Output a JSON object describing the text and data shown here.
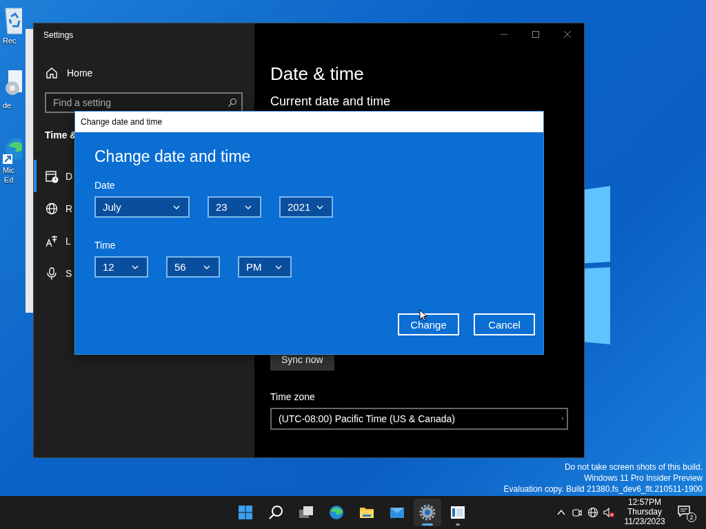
{
  "desktop": {
    "icons": [
      {
        "kind": "recycle-bin",
        "label": "Rec"
      },
      {
        "kind": "gear-file",
        "label": "de"
      },
      {
        "kind": "browser",
        "label": "Mic\nEd"
      }
    ]
  },
  "settings_window": {
    "title": "Settings",
    "home": "Home",
    "search": {
      "placeholder": "Find a setting"
    },
    "section": "Time &",
    "nav_items": [
      {
        "kind": "calendar",
        "label": "D",
        "selected": true
      },
      {
        "kind": "globe",
        "label": "R",
        "selected": false
      },
      {
        "kind": "language",
        "label": "L",
        "selected": false
      },
      {
        "kind": "microphone",
        "label": "S",
        "selected": false
      }
    ],
    "page": {
      "heading": "Date & time",
      "subheading": "Current date and time",
      "sync_button": "Sync now",
      "time_zone_label": "Time zone",
      "time_zone_value": "(UTC-08:00) Pacific Time (US & Canada)"
    }
  },
  "dialog": {
    "title": "Change date and time",
    "heading": "Change date and time",
    "date_label": "Date",
    "date_fields": [
      {
        "value": "July",
        "kind": "month"
      },
      {
        "value": "23",
        "kind": "day"
      },
      {
        "value": "2021",
        "kind": "year"
      }
    ],
    "time_label": "Time",
    "time_fields": [
      {
        "value": "12"
      },
      {
        "value": "56"
      },
      {
        "value": "PM"
      }
    ],
    "buttons": [
      {
        "label": "Change"
      },
      {
        "label": "Cancel"
      }
    ]
  },
  "watermark": [
    "Do not take screen shots of this build.",
    "Windows 11 Pro Insider Preview",
    "Evaluation copy. Build 21380.fs_dev6_flt.210511-1900"
  ],
  "taskbar": {
    "apps": [
      {
        "kind": "start",
        "active": false,
        "running": false
      },
      {
        "kind": "search",
        "active": false,
        "running": false
      },
      {
        "kind": "task-view",
        "active": false,
        "running": false
      },
      {
        "kind": "browser",
        "active": false,
        "running": false
      },
      {
        "kind": "folder",
        "active": false,
        "running": false
      },
      {
        "kind": "mail",
        "active": false,
        "running": false
      },
      {
        "kind": "settings",
        "active": true,
        "running": true
      },
      {
        "kind": "app-window",
        "active": false,
        "running": true
      }
    ],
    "tray": [
      {
        "kind": "chevron"
      },
      {
        "kind": "meet"
      },
      {
        "kind": "network"
      },
      {
        "kind": "volume-muted"
      }
    ],
    "clock": {
      "time": "12:57PM",
      "day": "Thursday",
      "date": "11/23/2023"
    },
    "notification_count": "2"
  }
}
